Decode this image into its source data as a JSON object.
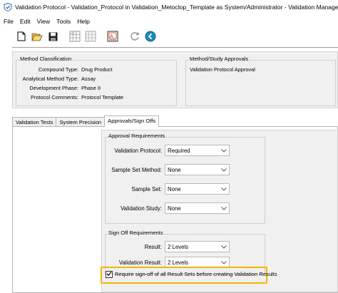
{
  "window": {
    "title": "Validation Protocol - Validation_Protocol in Validation_Metoclop_Template as System/Administrator - Validation Manager"
  },
  "menu": [
    "File",
    "Edit",
    "View",
    "Tools",
    "Help"
  ],
  "toolbar": {
    "icons": [
      "new-icon",
      "open-icon",
      "save-icon",
      "grid-icon",
      "grid-disabled-icon",
      "report-icon",
      "refresh-icon",
      "navigate-icon"
    ]
  },
  "method_classification": {
    "title": "Method Classification",
    "rows": [
      {
        "label": "Compound Type:",
        "value": "Drug Product"
      },
      {
        "label": "Analytical Method Type:",
        "value": "Assay"
      },
      {
        "label": "Development Phase:",
        "value": "Phase II"
      },
      {
        "label": "Protocol Comments:",
        "value": "Protocol Template"
      }
    ]
  },
  "approvals": {
    "title": "Method/Study Approvals",
    "item": "Validation Protocol Approval"
  },
  "tabs": [
    "Validation Tests",
    "System Precision",
    "Approvals/Sign Offs"
  ],
  "approval_requirements": {
    "title": "Approval Requirements",
    "fields": [
      {
        "label": "Validation Protocol:",
        "value": "Required"
      },
      {
        "label": "Sample Set Method:",
        "value": "None"
      },
      {
        "label": "Sample Set:",
        "value": "None"
      },
      {
        "label": "Validation Study:",
        "value": "None"
      }
    ]
  },
  "sign_off_requirements": {
    "title": "Sign Off Requirements",
    "fields": [
      {
        "label": "Result:",
        "value": "2 Levels"
      },
      {
        "label": "Validation Result:",
        "value": "2 Levels"
      }
    ]
  },
  "checkbox": {
    "label": "Require sign-off of all Result Sets before creating Validation Results",
    "checked": true
  },
  "colors": {
    "highlight": "#f4b400",
    "panel_bg": "#f0f0f0"
  }
}
